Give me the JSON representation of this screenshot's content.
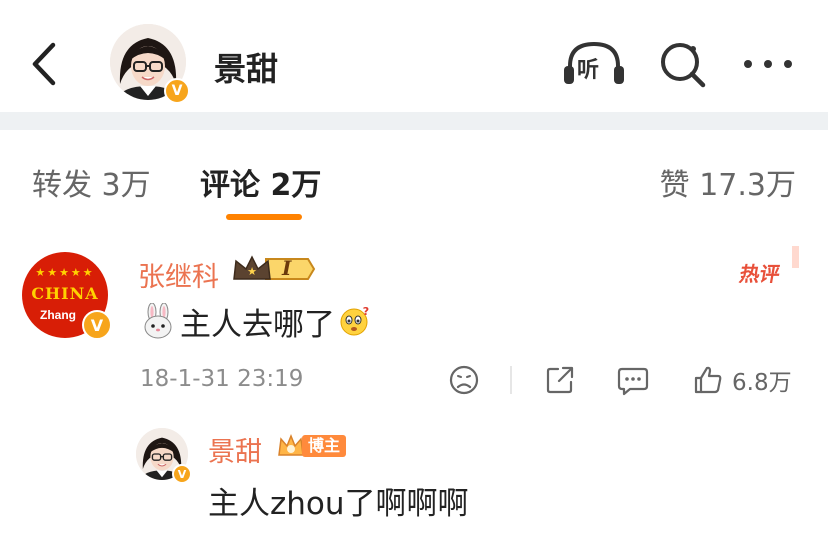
{
  "header": {
    "title": "景甜",
    "verified_mark": "V",
    "listen_label": "听",
    "back_icon": "chevron-left-icon",
    "search_icon": "search-icon",
    "more_icon": "more-icon"
  },
  "tabs": {
    "repost": "转发 3万",
    "comment": "评论 2万",
    "like": "赞 17.3万",
    "active": "comment"
  },
  "comment": {
    "author": "张继科",
    "level_badge": "I",
    "avatar_stars": "★★★★★",
    "avatar_text": "CHINA",
    "avatar_sub": "Zhang",
    "verified_mark": "V",
    "hot_label": "热评",
    "text": "主人去哪了",
    "time": "18-1-31 23:19",
    "like_count": "6.8万"
  },
  "reply": {
    "author": "景甜",
    "role_badge": "博主",
    "verified_mark": "V",
    "text": "主人zhou了啊啊啊"
  },
  "colors": {
    "accent": "#ff8200",
    "name": "#eb7350",
    "hot": "#e8503a",
    "verified": "#f7a51c",
    "band": "#eef1f3"
  }
}
